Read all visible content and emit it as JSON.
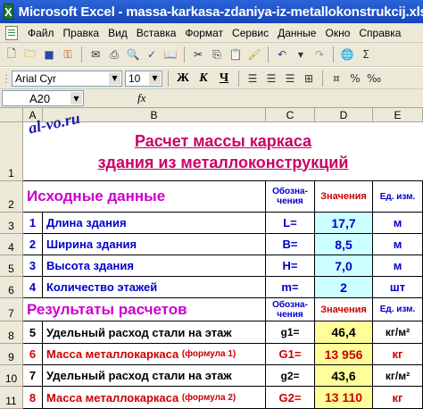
{
  "window": {
    "title": "Microsoft Excel - massa-karkasa-zdaniya-iz-metallokonstrukcij.xls",
    "app_icon": "X"
  },
  "menu": [
    "Файл",
    "Правка",
    "Вид",
    "Вставка",
    "Формат",
    "Сервис",
    "Данные",
    "Окно",
    "Справка"
  ],
  "format_toolbar": {
    "font": "Arial Cyr",
    "size": "10",
    "bold": "Ж",
    "italic": "К",
    "underline": "Ч"
  },
  "formula_bar": {
    "name_box": "A20",
    "fx": "fx"
  },
  "columns": [
    "A",
    "B",
    "C",
    "D",
    "E"
  ],
  "rows": [
    "1",
    "2",
    "3",
    "4",
    "5",
    "6",
    "7",
    "8",
    "9",
    "10",
    "11"
  ],
  "watermark": "al-vo.ru",
  "title": {
    "line1": "Расчет массы каркаса",
    "line2": "здания из металлоконструкций"
  },
  "input_section": {
    "heading": "Исходные данные",
    "col_designation": "Обозна-чения",
    "col_value": "Значения",
    "col_unit": "Ед. изм.",
    "rows": [
      {
        "n": "1",
        "label": "Длина здания",
        "sym": "L=",
        "value": "17,7",
        "unit": "м"
      },
      {
        "n": "2",
        "label": "Ширина здания",
        "sym": "B=",
        "value": "8,5",
        "unit": "м"
      },
      {
        "n": "3",
        "label": "Высота здания",
        "sym": "H=",
        "value": "7,0",
        "unit": "м"
      },
      {
        "n": "4",
        "label": "Количество этажей",
        "sym": "m=",
        "value": "2",
        "unit": "шт"
      }
    ]
  },
  "results_section": {
    "heading": "Результаты расчетов",
    "col_designation": "Обозна-чения",
    "col_value": "Значения",
    "col_unit": "Ед. изм.",
    "rows": [
      {
        "n": "5",
        "label": "Удельный расход стали на этаж",
        "sym": "g1=",
        "value": "46,4",
        "unit": "кг/м²",
        "style": "black"
      },
      {
        "n": "6",
        "label": "Масса металлокаркаса",
        "label_small": "(формула 1)",
        "sym": "G1=",
        "value": "13 956",
        "unit": "кг",
        "style": "red"
      },
      {
        "n": "7",
        "label": "Удельный расход стали на этаж",
        "sym": "g2=",
        "value": "43,6",
        "unit": "кг/м²",
        "style": "black"
      },
      {
        "n": "8",
        "label": "Масса металлокаркаса",
        "label_small": "(формула 2)",
        "sym": "G2=",
        "value": "13 110",
        "unit": "кг",
        "style": "red"
      }
    ]
  },
  "icons": [
    "new-doc-icon",
    "open-icon",
    "save-icon",
    "permissions-icon",
    "email-icon",
    "print-icon",
    "print-preview-icon",
    "spelling-icon",
    "research-icon",
    "cut-icon",
    "copy-icon",
    "paste-icon",
    "format-painter-icon",
    "undo-icon",
    "redo-icon",
    "hyperlink-icon",
    "autosum-icon"
  ]
}
